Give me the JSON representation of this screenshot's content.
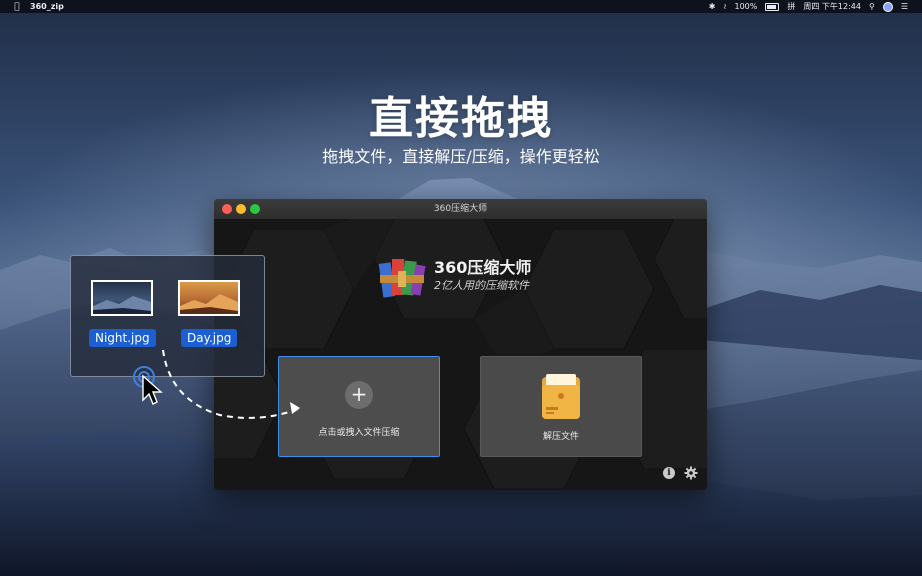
{
  "menubar": {
    "app_name": "360_zip",
    "battery": "100%",
    "input_method": "拼",
    "datetime": "周四 下午12:44"
  },
  "hero": {
    "title": "直接拖拽",
    "subtitle": "拖拽文件，直接解压/压缩，操作更轻松"
  },
  "window": {
    "title": "360压缩大师",
    "brand": "360压缩大师",
    "slogan": "2亿人用的压缩软件",
    "compress_label": "点击或拽入文件压缩",
    "extract_label": "解压文件",
    "info_icon": "i"
  },
  "drag": {
    "files": [
      "Night.jpg",
      "Day.jpg"
    ]
  },
  "colors": {
    "accent_blue": "#1c5fd2",
    "window_bg": "#161616",
    "card_bg": "#4a4a4a"
  }
}
